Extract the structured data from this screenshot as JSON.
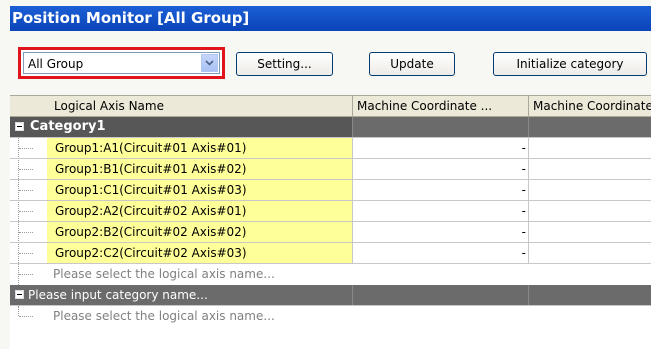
{
  "window": {
    "title": "Position Monitor [All Group]"
  },
  "toolbar": {
    "group_select": {
      "value": "All Group"
    },
    "setting_label": "Setting...",
    "update_label": "Update",
    "initialize_label": "Initialize category"
  },
  "grid": {
    "columns": [
      "Logical Axis Name",
      "Machine Coordinate ...",
      "Machine Coordinate"
    ],
    "category1": {
      "name": "Category1"
    },
    "rows": [
      {
        "name": "Group1:A1(Circuit#01 Axis#01)",
        "value1": "-",
        "value2": ""
      },
      {
        "name": "Group1:B1(Circuit#01 Axis#02)",
        "value1": "-",
        "value2": ""
      },
      {
        "name": "Group1:C1(Circuit#01 Axis#03)",
        "value1": "-",
        "value2": ""
      },
      {
        "name": "Group2:A2(Circuit#02 Axis#01)",
        "value1": "-",
        "value2": ""
      },
      {
        "name": "Group2:B2(Circuit#02 Axis#02)",
        "value1": "-",
        "value2": ""
      },
      {
        "name": "Group2:C2(Circuit#02 Axis#03)",
        "value1": "-",
        "value2": ""
      }
    ],
    "select_axis_placeholder": "Please select the logical axis name...",
    "new_category_placeholder": "Please input category name...",
    "select_axis_placeholder_2": "Please select the logical axis name..."
  },
  "colors": {
    "title_bar": "#0a44b8",
    "highlight_border": "#e0141b",
    "axis_name_bg": "#ffff99",
    "category_bg": "#6b6b6b"
  }
}
